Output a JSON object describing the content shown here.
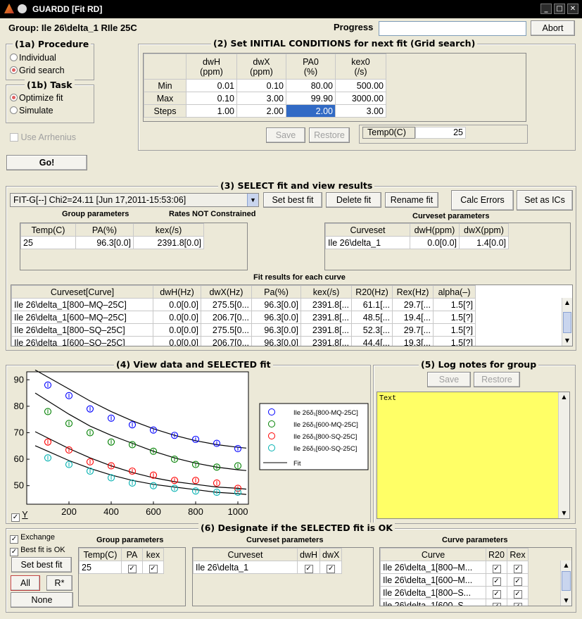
{
  "window": {
    "title": "GUARDD [Fit RD]",
    "min": "_",
    "max": "□",
    "close": "✕"
  },
  "header": {
    "group_label": "Group: Ile 26\\delta_1 RIle 25C",
    "progress_label": "Progress",
    "progress_value": "",
    "abort": "Abort"
  },
  "procedure": {
    "title": "(1a) Procedure",
    "opt1": "Individual",
    "opt2": "Grid search",
    "selected": "Grid search"
  },
  "task": {
    "title": "(1b) Task",
    "opt1": "Optimize fit",
    "opt2": "Simulate",
    "selected": "Optimize fit"
  },
  "arrhenius": {
    "label": "Use Arrhenius",
    "checked": false
  },
  "go": "Go!",
  "initial": {
    "title": "(2) Set INITIAL CONDITIONS for next fit (Grid search)",
    "headers": [
      "dwH\n(ppm)",
      "dwX\n(ppm)",
      "PA0\n(%)",
      "kex0\n(/s)"
    ],
    "rows": [
      {
        "label": "Min",
        "vals": [
          "0.01",
          "0.10",
          "80.00",
          "500.00"
        ]
      },
      {
        "label": "Max",
        "vals": [
          "0.10",
          "3.00",
          "99.90",
          "3000.00"
        ]
      },
      {
        "label": "Steps",
        "vals": [
          "1.00",
          "2.00",
          "2.00",
          "3.00"
        ]
      }
    ],
    "save": "Save",
    "restore": "Restore",
    "temp_label": "Temp0(C)",
    "temp_value": "25"
  },
  "select": {
    "title": "(3) SELECT fit and view results",
    "fit_dropdown": "FIT-G[--] Chi2=24.11 [Jun 17,2011-15:53:06]",
    "set_best": "Set best fit",
    "delete": "Delete fit",
    "rename": "Rename fit",
    "calc_errors": "Calc Errors",
    "set_ics": "Set as ICs",
    "group_params_label": "Group parameters",
    "rates_label": "Rates NOT Constrained",
    "group_headers": [
      "Temp(C)",
      "PA(%)",
      "kex(/s)"
    ],
    "group_row": [
      "25",
      "96.3[0.0]",
      "2391.8[0.0]"
    ],
    "curveset_label": "Curveset parameters",
    "curveset_headers": [
      "Curveset",
      "dwH(ppm)",
      "dwX(ppm)"
    ],
    "curveset_row": [
      "Ile 26\\delta_1",
      "0.0[0.0]",
      "1.4[0.0]"
    ],
    "fit_results_label": "Fit results for each curve",
    "fit_headers": [
      "Curveset[Curve]",
      "dwH(Hz)",
      "dwX(Hz)",
      "Pa(%)",
      "kex(/s)",
      "R20(Hz)",
      "Rex(Hz)",
      "alpha(–)"
    ],
    "fit_rows": [
      [
        "Ile 26\\delta_1[800–MQ–25C]",
        "0.0[0.0]",
        "275.5[0...",
        "96.3[0.0]",
        "2391.8[...",
        "61.1[...",
        "29.7[...",
        "1.5[?]"
      ],
      [
        "Ile 26\\delta_1[600–MQ–25C]",
        "0.0[0.0]",
        "206.7[0...",
        "96.3[0.0]",
        "2391.8[...",
        "48.5[...",
        "19.4[...",
        "1.5[?]"
      ],
      [
        "Ile 26\\delta_1[800–SQ–25C]",
        "0.0[0.0]",
        "275.5[0...",
        "96.3[0.0]",
        "2391.8[...",
        "52.3[...",
        "29.7[...",
        "1.5[?]"
      ],
      [
        "Ile 26\\delta_1[600–SQ–25C]",
        "0.0[0.0]",
        "206.7[0...",
        "96.3[0.0]",
        "2391.8[...",
        "44.4[...",
        "19.3[...",
        "1.5[?]"
      ]
    ]
  },
  "view": {
    "title": "(4) View data and SELECTED fit",
    "y_check": "Y",
    "legend": [
      "Ile 26δ₁[800-MQ-25C]",
      "Ile 26δ₁[600-MQ-25C]",
      "Ile 26δ₁[800-SQ-25C]",
      "Ile 26δ₁[600-SQ-25C]",
      "Fit"
    ]
  },
  "chart_data": {
    "type": "scatter",
    "xlim": [
      0,
      1050
    ],
    "ylim": [
      43,
      93
    ],
    "xticks": [
      200,
      400,
      600,
      800,
      1000
    ],
    "yticks": [
      50,
      60,
      70,
      80,
      90
    ],
    "x": [
      100,
      200,
      300,
      400,
      500,
      600,
      700,
      800,
      900,
      1000
    ],
    "series": [
      {
        "name": "Ile 26δ₁[800-MQ-25C]",
        "color": "#0000ff",
        "values": [
          88,
          84,
          79,
          75.5,
          73,
          71,
          69,
          67.5,
          66,
          64
        ]
      },
      {
        "name": "Ile 26δ₁[600-MQ-25C]",
        "color": "#008000",
        "values": [
          78,
          73.5,
          70,
          66.5,
          65.5,
          63,
          60,
          58,
          57,
          57.5
        ]
      },
      {
        "name": "Ile 26δ₁[800-SQ-25C]",
        "color": "#ff0000",
        "values": [
          66.5,
          63.5,
          59,
          57.5,
          55.5,
          54,
          52,
          52,
          51,
          49
        ]
      },
      {
        "name": "Ile 26δ₁[600-SQ-25C]",
        "color": "#00b0b0",
        "values": [
          60.5,
          58,
          55.5,
          53,
          51,
          50,
          49,
          48,
          47.5,
          47.5
        ]
      }
    ],
    "fits": [
      [
        91,
        86.5,
        82,
        78,
        74.5,
        71.5,
        69,
        67,
        65.5,
        64.5
      ],
      [
        82,
        77,
        72.5,
        69,
        66,
        63,
        60.5,
        58.5,
        57,
        56
      ],
      [
        68,
        64,
        60.5,
        57.5,
        55,
        53,
        51.5,
        50.5,
        49.5,
        49
      ],
      [
        63,
        59.5,
        56.5,
        54,
        52,
        50.5,
        49.5,
        48.5,
        47.5,
        47
      ]
    ]
  },
  "log": {
    "title": "(5) Log notes for group",
    "save": "Save",
    "restore": "Restore",
    "text": "Text"
  },
  "designate": {
    "title": "(6) Designate if the SELECTED fit is OK",
    "exchange": "Exchange",
    "best_fit_ok": "Best fit is OK",
    "set_best": "Set best fit",
    "all": "All",
    "rstar": "R*",
    "none": "None",
    "group_label": "Group parameters",
    "group_headers": [
      "Temp(C)",
      "PA",
      "kex"
    ],
    "group_row": "25",
    "curveset_label": "Curveset parameters",
    "curveset_headers": [
      "Curveset",
      "dwH",
      "dwX"
    ],
    "curveset_row": "Ile 26\\delta_1",
    "curve_label": "Curve parameters",
    "curve_headers": [
      "Curve",
      "R20",
      "Rex"
    ],
    "curve_rows": [
      "Ile 26\\delta_1[800–M...",
      "Ile 26\\delta_1[600–M...",
      "Ile 26\\delta_1[800–S...",
      "Ile 26\\delta_1[600–S..."
    ]
  }
}
